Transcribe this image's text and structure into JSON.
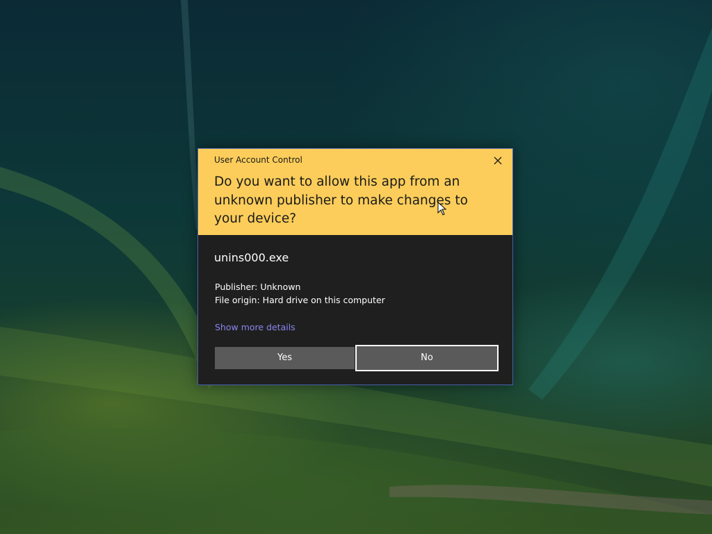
{
  "dialog": {
    "title": "User Account Control",
    "question": "Do you want to allow this app from an unknown publisher to make changes to your device?",
    "app_name": "unins000.exe",
    "publisher": "Publisher: Unknown",
    "file_origin": "File origin: Hard drive on this computer",
    "details_link": "Show more details",
    "yes_label": "Yes",
    "no_label": "No",
    "close_icon": "close-icon"
  },
  "colors": {
    "header_bg": "#fccd5a",
    "body_bg": "#1f1f1f",
    "link": "#8a86ef",
    "button_bg": "#5a5a5a",
    "border": "#4a5fb0"
  }
}
